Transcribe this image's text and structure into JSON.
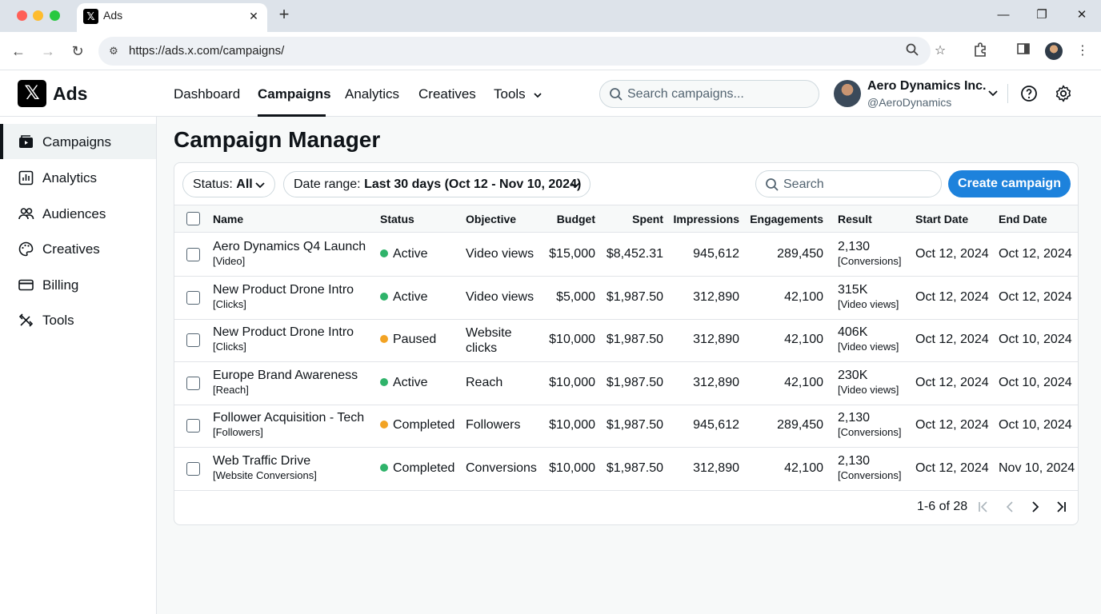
{
  "browser": {
    "tab_title": "Ads",
    "url": "https://ads.x.com/campaigns/",
    "colors": {
      "close": "#ff5f57",
      "minimize": "#febc2e",
      "maximize": "#28c840"
    }
  },
  "app": {
    "logo_glyph": "𝕏",
    "logo_text": "Ads",
    "nav": [
      "Dashboard",
      "Campaigns",
      "Analytics",
      "Creatives",
      "Tools"
    ],
    "active_nav": "Campaigns",
    "search_placeholder": "Search campaigns...",
    "account_name": "Aero Dynamics Inc.",
    "account_handle": "@AeroDynamics"
  },
  "sidebar": {
    "items": [
      {
        "label": "Campaigns",
        "icon": "campaigns-icon",
        "active": true
      },
      {
        "label": "Analytics",
        "icon": "analytics-icon"
      },
      {
        "label": "Audiences",
        "icon": "audiences-icon"
      },
      {
        "label": "Creatives",
        "icon": "creatives-icon"
      },
      {
        "label": "Billing",
        "icon": "billing-icon"
      },
      {
        "label": "Tools",
        "icon": "tools-icon"
      }
    ]
  },
  "main": {
    "title": "Campaign Manager",
    "status_filter_label": "Status:",
    "status_filter_value": "All",
    "date_filter_label": "Date range:",
    "date_filter_value": "Last 30 days (Oct 12 - Nov 10, 2024)",
    "search_placeholder": "Search",
    "create_label": "Create campaign",
    "columns": [
      "Name",
      "Status",
      "Objective",
      "Budget",
      "Spent",
      "Impressions",
      "Engagements",
      "Result",
      "Start Date",
      "End Date"
    ],
    "status_colors": {
      "Active": "#2fb36a",
      "Paused": "#f2a324",
      "Completed": "#f2a324"
    },
    "rows": [
      {
        "name": "Aero Dynamics Q4 Launch",
        "name_sub": "[Video]",
        "status": "Active",
        "status_color": "#2fb36a",
        "objective": "Video views",
        "budget": "$15,000",
        "spent": "$8,452.31",
        "impressions": "945,612",
        "engagements": "289,450",
        "result": "2,130",
        "result_sub": "[Conversions]",
        "start": "Oct 12, 2024",
        "end": "Oct 12, 2024"
      },
      {
        "name": "New Product Drone Intro",
        "name_sub": "[Clicks]",
        "status": "Active",
        "status_color": "#2fb36a",
        "objective": "Video views",
        "budget": "$5,000",
        "spent": "$1,987.50",
        "impressions": "312,890",
        "engagements": "42,100",
        "result": "315K",
        "result_sub": "[Video views]",
        "start": "Oct 12, 2024",
        "end": "Oct 12, 2024"
      },
      {
        "name": "New Product Drone Intro",
        "name_sub": "[Clicks]",
        "status": "Paused",
        "status_color": "#f2a324",
        "objective": "Website",
        "objective_2": "clicks",
        "budget": "$10,000",
        "spent": "$1,987.50",
        "impressions": "312,890",
        "engagements": "42,100",
        "result": "406K",
        "result_sub": "[Video views]",
        "start": "Oct 12, 2024",
        "end": "Oct 10, 2024"
      },
      {
        "name": "Europe Brand Awareness",
        "name_sub": "[Reach]",
        "status": "Active",
        "status_color": "#2fb36a",
        "objective": "Reach",
        "budget": "$10,000",
        "spent": "$1,987.50",
        "impressions": "312,890",
        "engagements": "42,100",
        "result": "230K",
        "result_sub": "[Video views]",
        "start": "Oct 12, 2024",
        "end": "Oct 10, 2024"
      },
      {
        "name": "Follower Acquisition - Tech",
        "name_sub": "[Followers]",
        "status": "Completed",
        "status_color": "#f2a324",
        "objective": "Followers",
        "budget": "$10,000",
        "spent": "$1,987.50",
        "impressions": "945,612",
        "engagements": "289,450",
        "result": "2,130",
        "result_sub": "[Conversions]",
        "start": "Oct 12, 2024",
        "end": "Oct 10, 2024"
      },
      {
        "name": "Web Traffic Drive",
        "name_sub": "[Website Conversions]",
        "status": "Completed",
        "status_color": "#2fb36a",
        "objective": "Conversions",
        "budget": "$10,000",
        "spent": "$1,987.50",
        "impressions": "312,890",
        "engagements": "42,100",
        "result": "2,130",
        "result_sub": "[Conversions]",
        "start": "Oct 12, 2024",
        "end": "Nov 10, 2024"
      }
    ],
    "pagination": "1-6 of 28"
  }
}
